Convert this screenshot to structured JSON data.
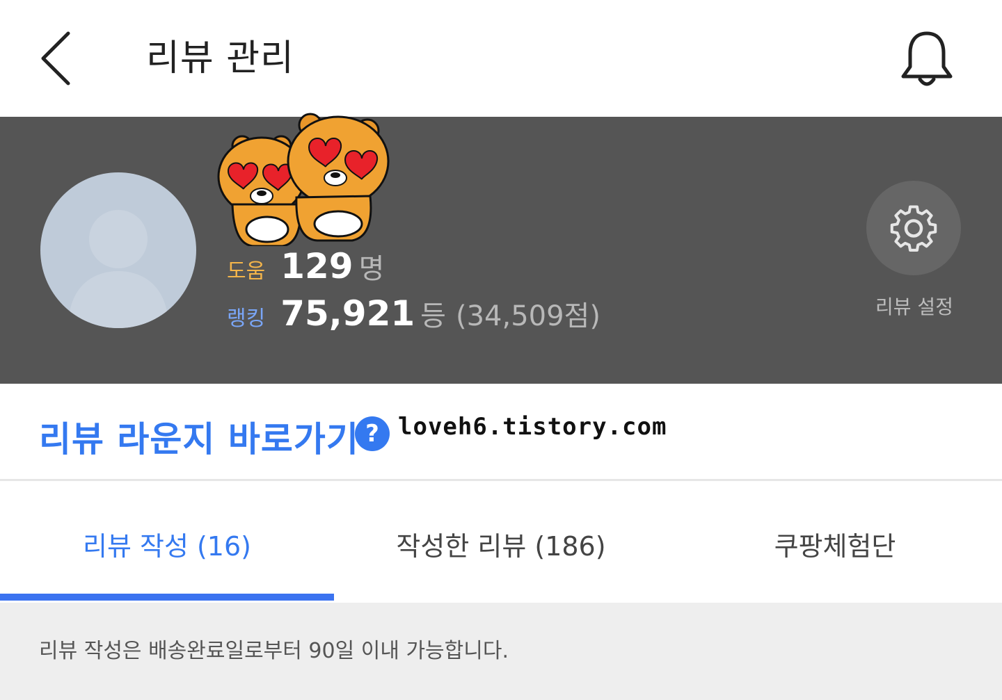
{
  "header": {
    "title": "리뷰 관리",
    "back_icon": "chevron-left-icon",
    "notification_icon": "bell-icon"
  },
  "profile": {
    "help": {
      "label": "도움",
      "value": "129",
      "unit": "명"
    },
    "ranking": {
      "label": "랭킹",
      "value": "75,921",
      "unit": "등",
      "score": "(34,509점)"
    },
    "settings_label": "리뷰 설정",
    "settings_icon": "gear-icon"
  },
  "lounge": {
    "link_label": "리뷰 라운지 바로가기",
    "help_glyph": "?",
    "watermark": "loveh6.tistory.com"
  },
  "tabs": [
    {
      "label": "리뷰 작성 (16)",
      "active": true
    },
    {
      "label": "작성한 리뷰 (186)",
      "active": false
    },
    {
      "label": "쿠팡체험단",
      "active": false
    }
  ],
  "notice": {
    "text": "리뷰 작성은 배송완료일로부터 90일 이내 가능합니다."
  },
  "colors": {
    "accent": "#3479f0",
    "profile_bg": "#555555",
    "help_label": "#f4b54a",
    "rank_label": "#7aa6f7",
    "notice_bg": "#eeeeee"
  }
}
